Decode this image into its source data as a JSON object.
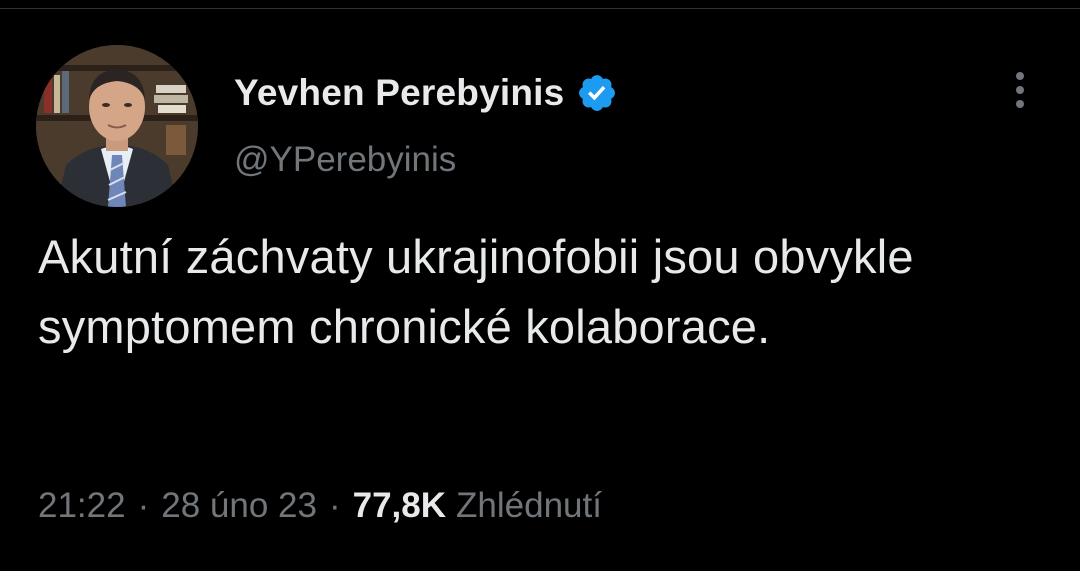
{
  "tweet": {
    "author": {
      "name": "Yevhen Perebyinis",
      "handle": "@YPerebyinis",
      "verified": true
    },
    "text": "Akutní záchvaty ukrajinofobii jsou obvykle symptomem chronické kolaborace.",
    "time": "21:22",
    "date": "28 úno 23",
    "separator": "·",
    "views_count": "77,8K",
    "views_label": "Zhlédnutí"
  },
  "colors": {
    "background": "#000000",
    "primary_text": "#e7e9ea",
    "secondary_text": "#71767b",
    "verified_badge": "#1d9bf0"
  },
  "icons": {
    "verified": "verified-badge-icon",
    "more": "more-options-icon"
  }
}
